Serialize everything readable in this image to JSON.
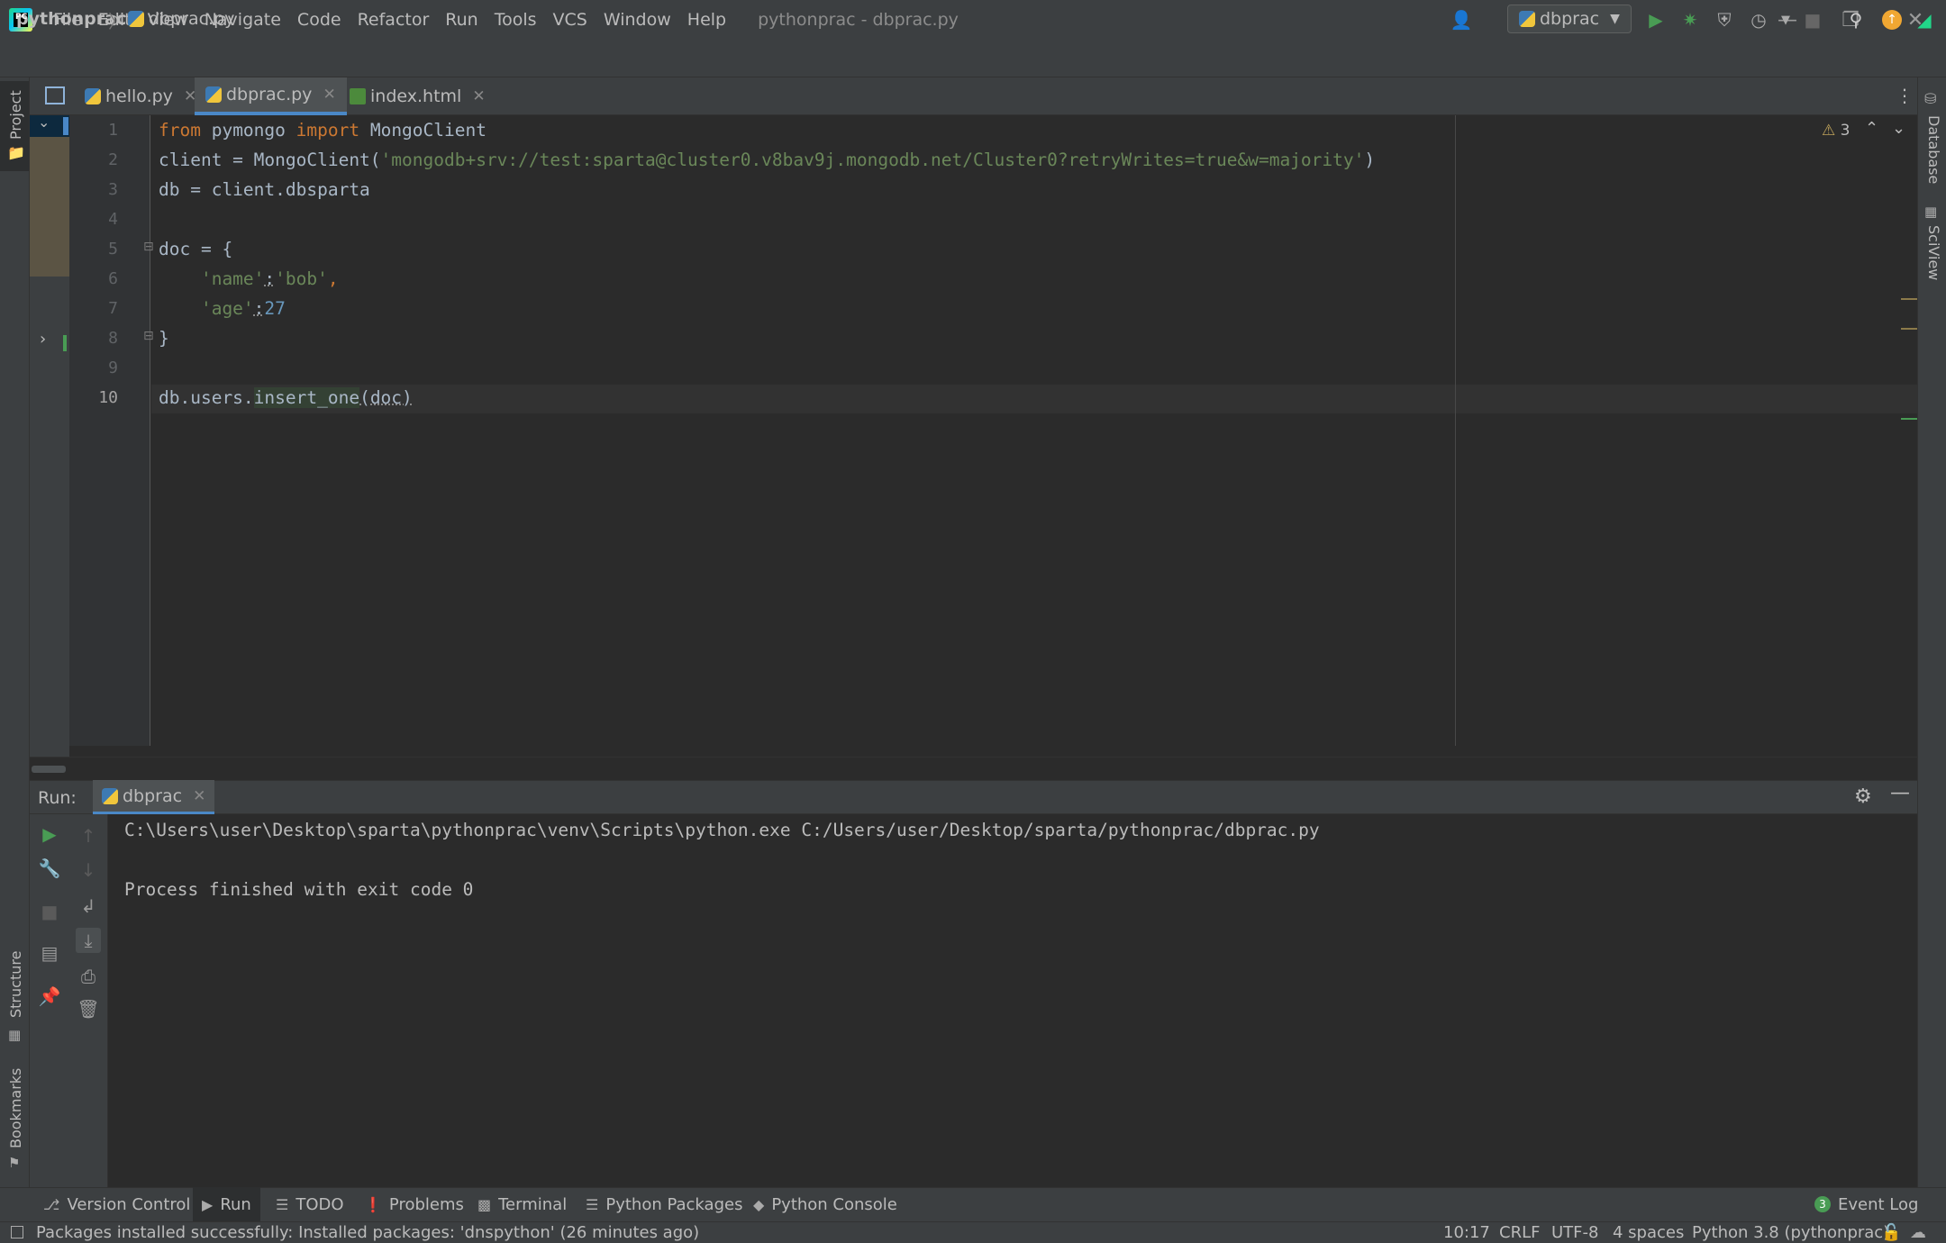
{
  "menu": [
    "File",
    "Edit",
    "View",
    "Navigate",
    "Code",
    "Refactor",
    "Run",
    "Tools",
    "VCS",
    "Window",
    "Help"
  ],
  "window_title": "pythonprac - dbprac.py",
  "logo_text": "PC",
  "breadcrumb": {
    "project": "pythonprac",
    "file": "dbprac.py"
  },
  "run_config": {
    "name": "dbprac"
  },
  "left_strip": {
    "project": "Project",
    "structure": "Structure",
    "bookmarks": "Bookmarks"
  },
  "right_strip": {
    "database": "Database",
    "sciview": "SciView"
  },
  "editor_tabs": [
    {
      "label": "hello.py",
      "type": "py",
      "active": false
    },
    {
      "label": "dbprac.py",
      "type": "py",
      "active": true
    },
    {
      "label": "index.html",
      "type": "html",
      "active": false
    }
  ],
  "inspection": {
    "warnings": "3"
  },
  "code_lines": {
    "l1": {
      "n": "1",
      "kw1": "from",
      "t1": " pymongo ",
      "kw2": "import",
      "t2": " MongoClient"
    },
    "l2": {
      "n": "2",
      "t1": "client = MongoClient(",
      "s1": "'mongodb+srv://test:sparta@cluster0.v8bav9j.mongodb.net/Cluster0?retryWrites=true&w=majority'",
      "t2": ")"
    },
    "l3": {
      "n": "3",
      "t1": "db = client.dbsparta"
    },
    "l4": {
      "n": "4"
    },
    "l5": {
      "n": "5",
      "t1": "doc = {"
    },
    "l6": {
      "n": "6",
      "s1": "    'name'",
      "t1": ":",
      "s2": "'bob'",
      "t2": ","
    },
    "l7": {
      "n": "7",
      "s1": "    'age'",
      "t1": ":",
      "num": "27"
    },
    "l8": {
      "n": "8",
      "t1": "}"
    },
    "l9": {
      "n": "9"
    },
    "l10": {
      "n": "10",
      "t1": "db.users.",
      "fn": "insert_one",
      "t2": "(doc)"
    }
  },
  "run_panel": {
    "label": "Run:",
    "tab": "dbprac",
    "output": [
      "C:\\Users\\user\\Desktop\\sparta\\pythonprac\\venv\\Scripts\\python.exe C:/Users/user/Desktop/sparta/pythonprac/dbprac.py",
      "",
      "Process finished with exit code 0"
    ]
  },
  "bottom_tabs": {
    "version_control": "Version Control",
    "run": "Run",
    "todo": "TODO",
    "problems": "Problems",
    "terminal": "Terminal",
    "python_packages": "Python Packages",
    "python_console": "Python Console",
    "event_log": "Event Log",
    "event_log_count": "3"
  },
  "status_bar": {
    "message": "Packages installed successfully: Installed packages: 'dnspython' (26 minutes ago)",
    "position": "10:17",
    "line_sep": "CRLF",
    "encoding": "UTF-8",
    "indent": "4 spaces",
    "interpreter": "Python 3.8 (pythonprac)"
  },
  "colors": {
    "keyword": "#cc7832",
    "string": "#6a8759",
    "number": "#6897bb",
    "accent": "#4a88c7",
    "run_green": "#499c54"
  }
}
